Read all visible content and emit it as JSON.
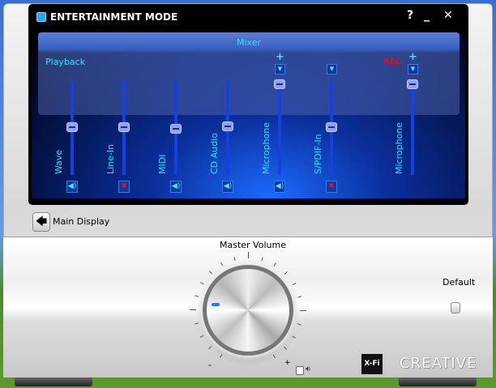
{
  "window": {
    "title": "ENTERTAINMENT MODE",
    "help": "?",
    "minimize": "_",
    "close": "✕"
  },
  "mixer": {
    "title": "Mixer",
    "playback_label": "Playback",
    "rec_label": "REC",
    "plus": "+",
    "channels": [
      {
        "label": "Wave",
        "level": 0.5,
        "muted": false
      },
      {
        "label": "Line-In",
        "level": 0.5,
        "muted": true
      },
      {
        "label": "MIDI",
        "level": 0.48,
        "muted": false
      },
      {
        "label": "CD Audio",
        "level": 0.51,
        "muted": false
      },
      {
        "label": "Microphone",
        "level": 0.95,
        "muted": false
      },
      {
        "label": "S/PDIF-In",
        "level": 0.5,
        "muted": true
      },
      {
        "label": "Microphone",
        "level": 0.95,
        "muted": null
      }
    ]
  },
  "nav": {
    "main_display": "Main Display"
  },
  "master": {
    "label": "Master Volume",
    "min": "-",
    "max": "+",
    "level": 0.2
  },
  "default_label": "Default",
  "brand": {
    "xfi": "X-Fi",
    "creative": "CREATIVE"
  },
  "colors": {
    "accent": "#37e0ff",
    "rec": "#e01020"
  }
}
